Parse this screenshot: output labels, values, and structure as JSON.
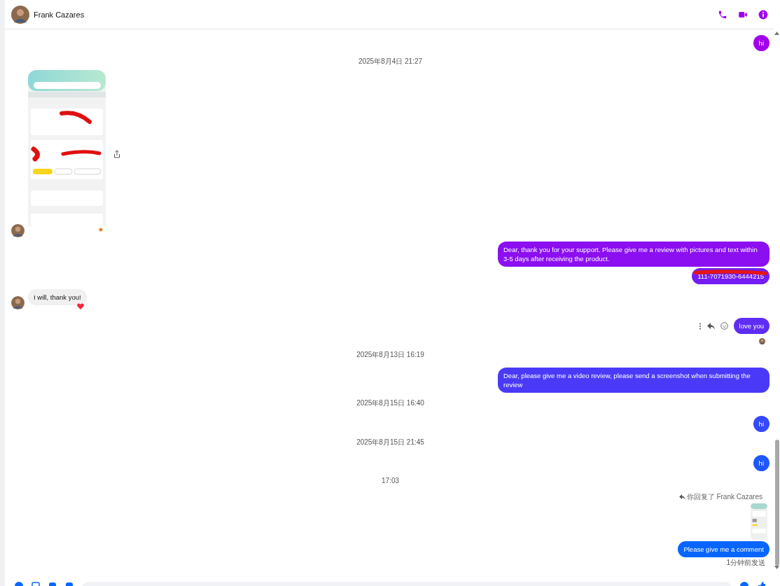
{
  "header": {
    "contact_name": "Frank Cazares"
  },
  "messages": [
    {
      "kind": "outgoing",
      "text": "hi"
    },
    {
      "kind": "timestamp",
      "text": "2025年8月4日 21:27"
    },
    {
      "kind": "incoming_image"
    },
    {
      "kind": "outgoing",
      "text": "Dear, thank you for your support. Please give me a review with pictures and text within 3-5 days after receiving the product."
    },
    {
      "kind": "outgoing",
      "text": "111-7071930-6444215",
      "redacted": true
    },
    {
      "kind": "incoming",
      "text": "I will, thank you!",
      "reacted": true
    },
    {
      "kind": "outgoing",
      "text": "love you",
      "seen": true,
      "actions_shown": true
    },
    {
      "kind": "timestamp",
      "text": "2025年8月13日 16:19"
    },
    {
      "kind": "outgoing",
      "text": "Dear, please give me a video review, please send a screenshot when submitting the review"
    },
    {
      "kind": "timestamp",
      "text": "2025年8月15日 16:40"
    },
    {
      "kind": "outgoing",
      "text": "hi"
    },
    {
      "kind": "timestamp",
      "text": "2025年8月15日 21:45"
    },
    {
      "kind": "outgoing",
      "text": "hi"
    },
    {
      "kind": "timestamp",
      "text": "17:03"
    },
    {
      "kind": "outgoing_reply",
      "reply_label": "你回复了 Frank Cazares",
      "text": "Please give me a comment",
      "status": "1分钟前发送"
    }
  ]
}
